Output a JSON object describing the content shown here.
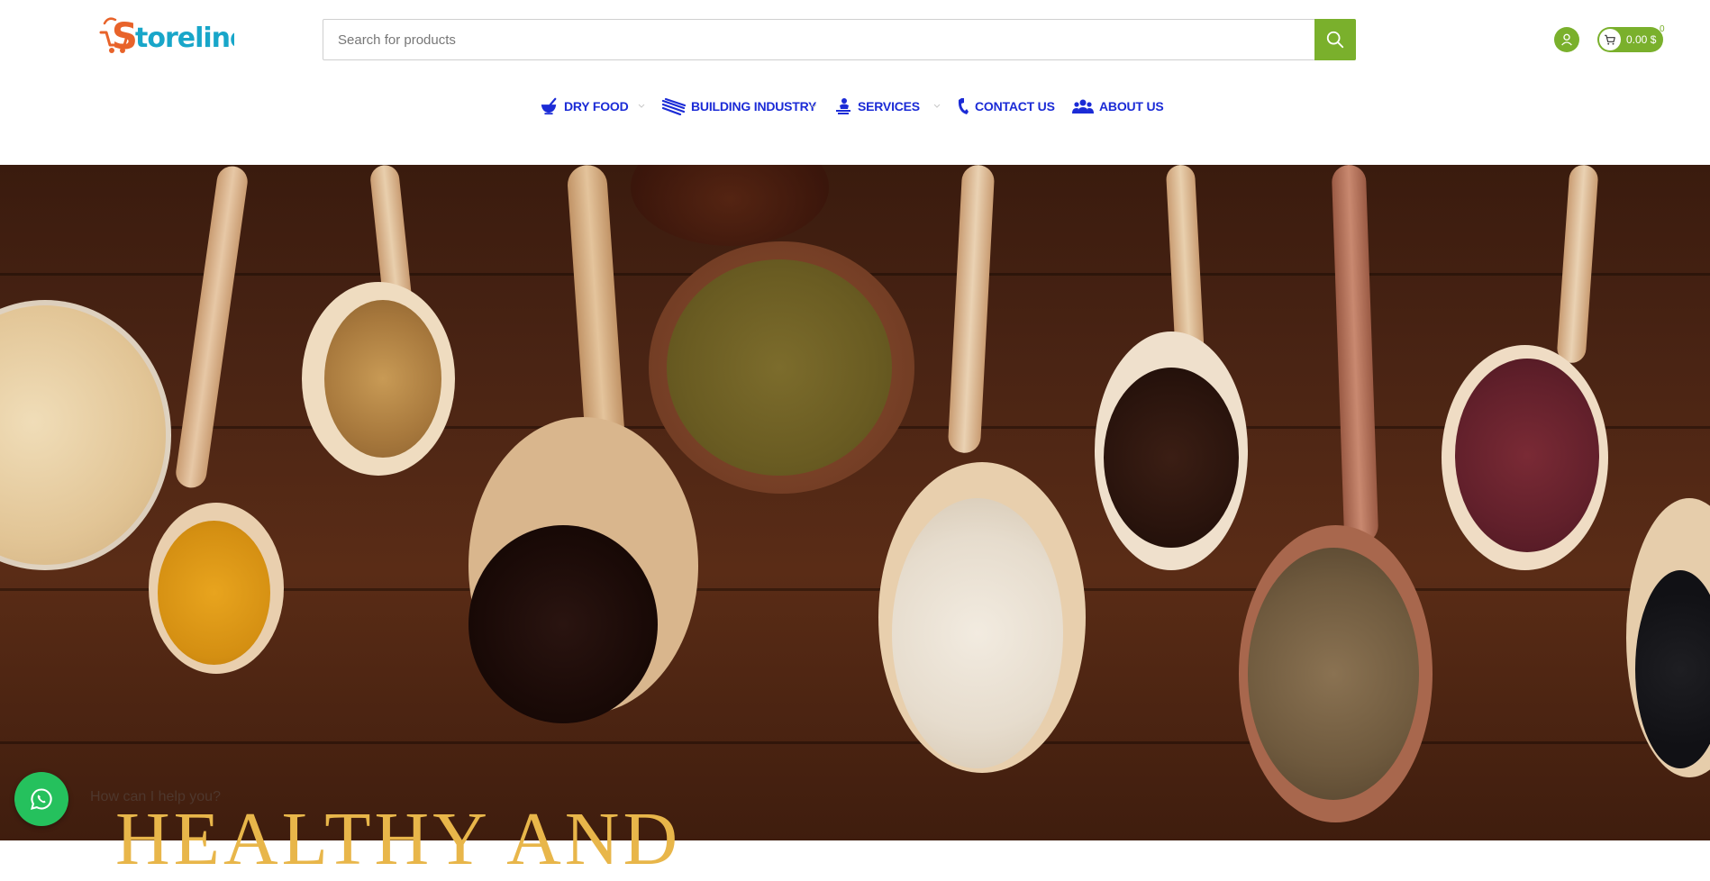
{
  "brand": {
    "logo_text": "Storeline",
    "accent": "#7ab02c",
    "logo_orange": "#e8632a",
    "logo_teal": "#18a6c9"
  },
  "search": {
    "placeholder": "Search for products",
    "icon": "search-icon"
  },
  "header_actions": {
    "user_icon": "user-icon",
    "cart_icon": "cart-icon",
    "cart_total": "0.00 $",
    "cart_count": "0"
  },
  "nav": {
    "color": "#1b2bd6",
    "items": [
      {
        "label": "DRY FOOD",
        "icon": "mortar-icon",
        "has_dropdown": true
      },
      {
        "label": "BUILDING INDUSTRY",
        "icon": "rebar-icon",
        "has_dropdown": true
      },
      {
        "label": "SERVICES",
        "icon": "service-worker-icon",
        "has_dropdown": true
      },
      {
        "label": "CONTACT US",
        "icon": "phone-icon",
        "has_dropdown": false
      },
      {
        "label": "ABOUT US",
        "icon": "group-icon",
        "has_dropdown": false
      }
    ]
  },
  "hero": {
    "title": "HEALTHY AND",
    "title_color": "#e8b64a"
  },
  "whatsapp": {
    "tooltip": "How can I help you?",
    "icon": "whatsapp-icon",
    "color": "#25c15d"
  }
}
